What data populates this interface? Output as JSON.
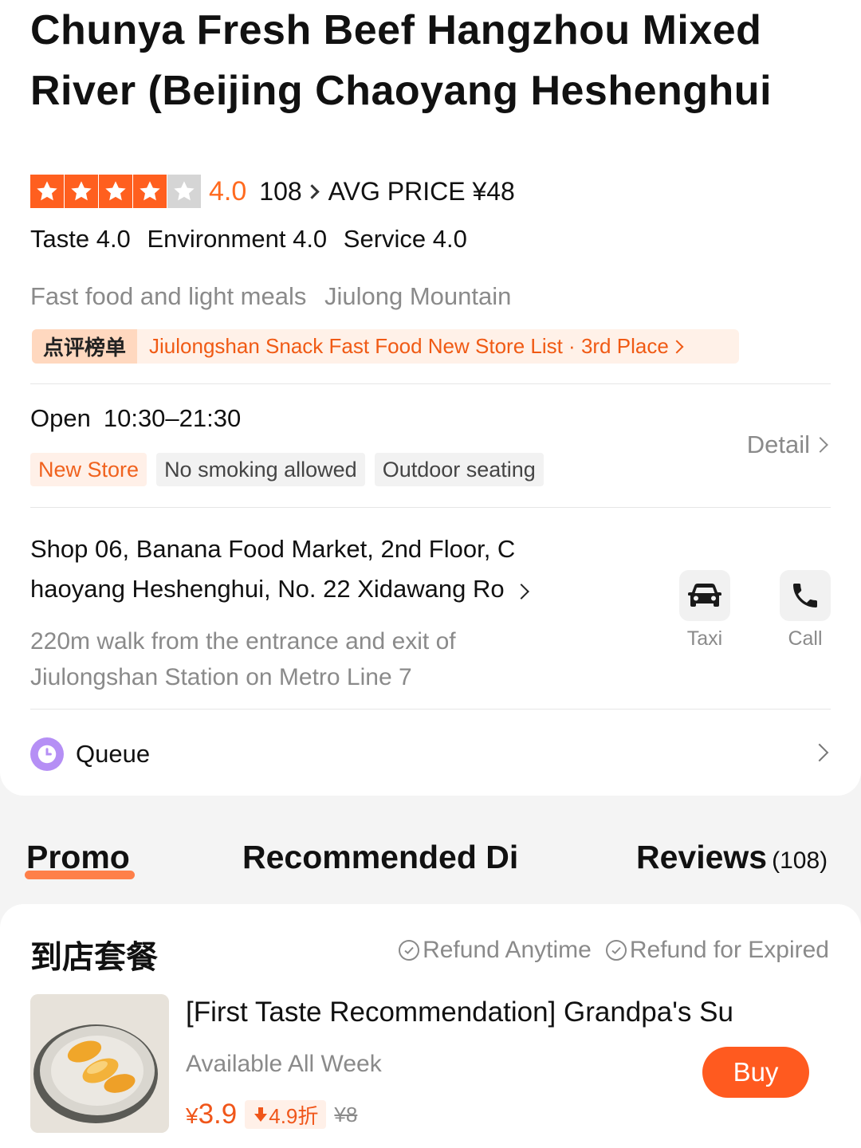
{
  "shop": {
    "title_line1": "Chunya Fresh Beef Hangzhou Mixed",
    "title_line2": "River (Beijing Chaoyang Heshenghui",
    "rating": {
      "stars": 4,
      "stars_max": 5,
      "score": "4.0",
      "review_count": "108",
      "avg_price": "AVG PRICE ¥48"
    },
    "sub_scores": [
      "Taste 4.0",
      "Environment 4.0",
      "Service 4.0"
    ],
    "category": [
      "Fast food and light meals",
      "Jiulong Mountain"
    ],
    "rank": {
      "tag": "点评榜单",
      "text": "Jiulongshan Snack Fast Food New Store List · 3rd Place"
    },
    "hours": {
      "label": "Open",
      "value": "10:30–21:30"
    },
    "tags": [
      "New Store",
      "No smoking allowed",
      "Outdoor seating"
    ],
    "detail_label": "Detail",
    "address_line1": "Shop 06, Banana Food Market, 2nd Floor, C",
    "address_line2": "haoyang Heshenghui, No. 22 Xidawang Ro",
    "metro_line1": "220m walk from the entrance and exit of",
    "metro_line2": "Jiulongshan Station on Metro Line 7",
    "actions": {
      "taxi": "Taxi",
      "call": "Call"
    },
    "queue_label": "Queue"
  },
  "tabs": {
    "promo": "Promo",
    "recommended": "Recommended Di",
    "reviews": "Reviews",
    "reviews_count": "(108)"
  },
  "deals": {
    "header": "到店套餐",
    "refund_anytime": "Refund Anytime",
    "refund_expired": "Refund for Expired",
    "item": {
      "title": "[First Taste Recommendation] Grandpa's Su",
      "availability": "Available All Week",
      "currency": "¥",
      "price": "3.9",
      "discount": "4.9折",
      "original_price": "¥8",
      "buy_label": "Buy"
    }
  },
  "colors": {
    "accent": "#ff5a1f",
    "star_on": "#ff5f1f",
    "star_off": "#d5d5d5",
    "queue_icon": "#b58ff5"
  },
  "icons": [
    "star-icon",
    "chevron-right-icon",
    "car-icon",
    "phone-icon",
    "clock-icon",
    "check-circle-icon",
    "down-arrow-icon"
  ]
}
